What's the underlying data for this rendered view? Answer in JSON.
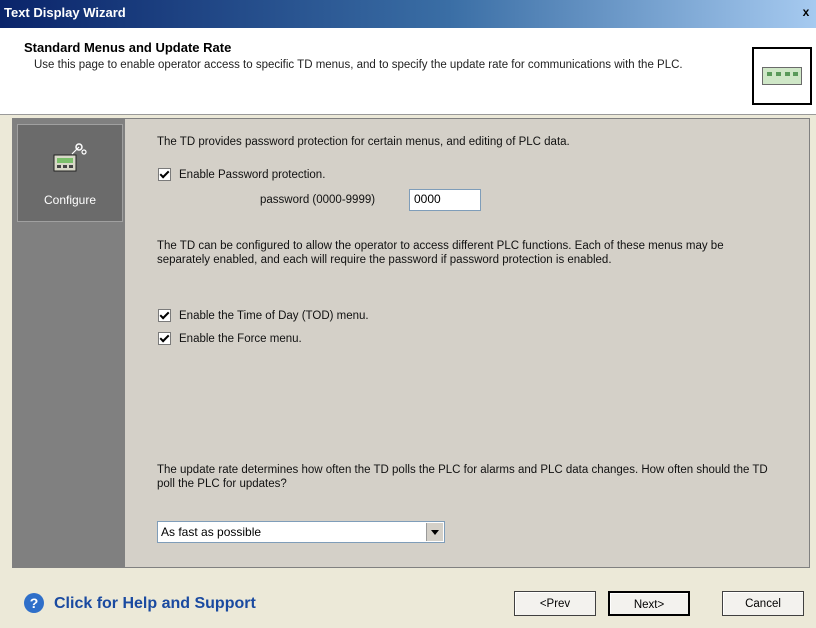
{
  "window": {
    "title": "Text Display Wizard",
    "close_glyph": "x"
  },
  "header": {
    "title": "Standard Menus and Update Rate",
    "description": "Use this page to enable operator access to specific TD menus, and to specify the update rate for communications with the PLC."
  },
  "nav": {
    "items": [
      {
        "label": "Configure",
        "icon": "td-device-icon"
      }
    ]
  },
  "content": {
    "intro": "The TD provides password protection for certain menus, and editing of PLC data.",
    "password_protection": {
      "label": "Enable Password protection.",
      "checked": true
    },
    "password": {
      "label": "password (0000-9999)",
      "value": "0000"
    },
    "menus_intro": "The TD can be configured to allow the operator to access different PLC functions. Each of these menus may be separately enabled, and each will require the password if password protection is enabled.",
    "tod_menu": {
      "label": "Enable the Time of Day (TOD) menu.",
      "checked": true
    },
    "force_menu": {
      "label": "Enable the Force menu.",
      "checked": true
    },
    "update_intro": "The update rate determines how often the TD polls the PLC for alarms and PLC data changes. How often should the TD poll the PLC for updates?",
    "update_rate": {
      "selected": "As fast as possible"
    }
  },
  "footer": {
    "help_label": "Click for Help and Support",
    "prev_label": "<Prev",
    "next_label": "Next>",
    "cancel_label": "Cancel"
  }
}
